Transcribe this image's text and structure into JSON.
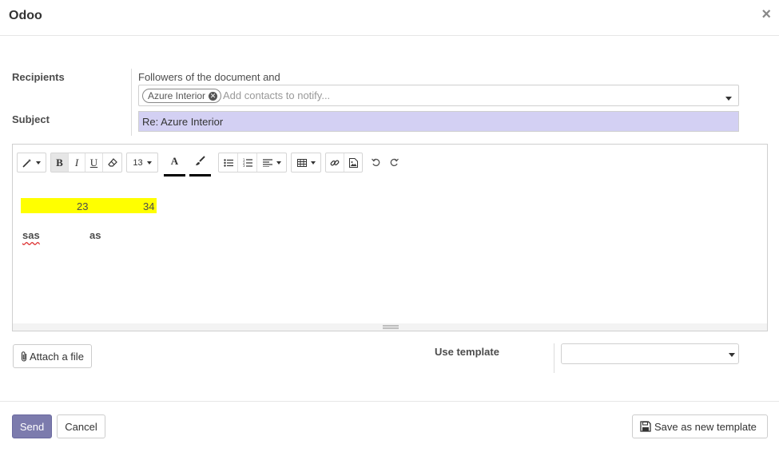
{
  "dialog": {
    "title": "Odoo",
    "close_glyph": "×"
  },
  "form": {
    "recipients_label": "Recipients",
    "followers_text": "Followers of the document and",
    "recipient_tags": [
      "Azure Interior"
    ],
    "recipients_placeholder": "Add contacts to notify...",
    "subject_label": "Subject",
    "subject_value": "Re: Azure Interior"
  },
  "toolbar": {
    "font_size": "13",
    "text_color_glyph": "A",
    "buttons": [
      "magic-wand",
      "bold",
      "italic",
      "underline",
      "eraser",
      "font-size",
      "text-color",
      "background-color",
      "unordered-list",
      "ordered-list",
      "paragraph-align",
      "table",
      "link",
      "image",
      "undo",
      "redo"
    ]
  },
  "editor": {
    "highlighted_row": [
      "23",
      "34"
    ],
    "highlight_color": "#ffff00",
    "text_row": [
      "sas",
      "as"
    ]
  },
  "actions": {
    "attach_file_label": "Attach a file",
    "use_template_label": "Use template",
    "template_selected": "",
    "send_label": "Send",
    "cancel_label": "Cancel",
    "save_template_label": "Save as new template"
  },
  "colors": {
    "primary": "#7c7bad",
    "subject_highlight": "#d3d0f3"
  }
}
